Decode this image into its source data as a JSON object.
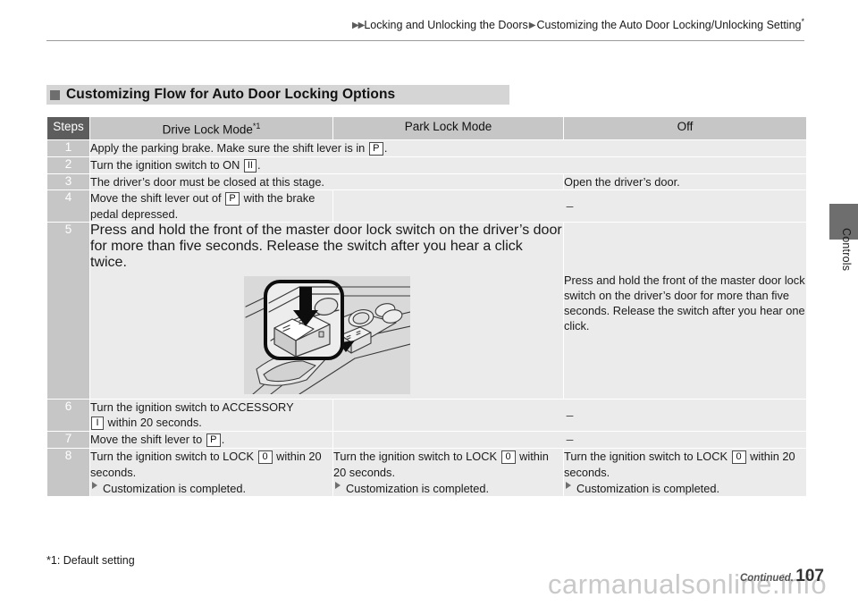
{
  "header": {
    "arrow_double": "▶▶",
    "arrow_single": "▶",
    "breadcrumb_1": "Locking and Unlocking the Doors",
    "breadcrumb_2": "Customizing the Auto Door Locking/Unlocking Setting",
    "breadcrumb_2_sup": "*"
  },
  "thumb_tab": {
    "label": "Controls"
  },
  "section": {
    "title": "Customizing Flow for Auto Door Locking Options"
  },
  "table": {
    "headers": {
      "steps": "Steps",
      "drive_lock_mode": "Drive Lock Mode",
      "drive_lock_mode_sup": "*1",
      "park_lock_mode": "Park Lock Mode",
      "off": "Off"
    },
    "rows": [
      {
        "step": "1",
        "span": "all",
        "drive": {
          "text_a": "Apply the parking brake. Make sure the shift lever is in ",
          "glyph": "P",
          "text_b": "."
        }
      },
      {
        "step": "2",
        "span": "all",
        "drive": {
          "text_a": "Turn the ignition switch to ON ",
          "glyph": "II",
          "text_b": "."
        }
      },
      {
        "step": "3",
        "span": "two-one",
        "drive": {
          "text_a": "The driver’s door must be closed at this stage.",
          "glyph": "",
          "text_b": ""
        },
        "off": {
          "text_a": "Open the driver’s door.",
          "glyph": "",
          "text_b": ""
        }
      },
      {
        "step": "4",
        "span": "one-two",
        "drive": {
          "text_a": "Move the shift lever out of ",
          "glyph": "P",
          "text_b": " with the brake pedal depressed."
        },
        "merged": "–"
      },
      {
        "step": "5",
        "span": "two-one-illus",
        "drive": {
          "text_a": "Press and hold the front of the master door lock switch on the driver’s door for more than five seconds. Release the switch after you hear a click twice."
        },
        "off": {
          "text_a": "Press and hold the front of the master door lock switch on the driver’s door for more than five seconds. Release the switch after you hear one click."
        },
        "illustration_name": "door-panel-master-lock-switch"
      },
      {
        "step": "6",
        "span": "one-two",
        "drive": {
          "text_a": "Turn the ignition switch to ACCESSORY ",
          "glyph": "I",
          "text_b": " within 20 seconds."
        },
        "merged": "–"
      },
      {
        "step": "7",
        "span": "one-two",
        "drive": {
          "text_a": "Move the shift lever to ",
          "glyph": "P",
          "text_b": "."
        },
        "merged": "–"
      },
      {
        "step": "8",
        "span": "three",
        "drive": {
          "text_a": "Turn the ignition switch to LOCK ",
          "glyph": "0",
          "text_b": " within 20 seconds.",
          "sub": "Customization is completed."
        },
        "park": {
          "text_a": "Turn the ignition switch to LOCK ",
          "glyph": "0",
          "text_b": " within 20 seconds.",
          "sub": "Customization is completed."
        },
        "off": {
          "text_a": "Turn the ignition switch to LOCK ",
          "glyph": "0",
          "text_b": " within 20 seconds.",
          "sub": "Customization is completed."
        }
      }
    ]
  },
  "footnote": "*1: Default setting",
  "watermark": "carmanualsonline.info",
  "footer": {
    "continued": "Continued.",
    "page_number": "107"
  },
  "colors": {
    "header_dark": "#5d5d5d",
    "header_light": "#c6c6c6",
    "cell_bg": "#ebebeb",
    "step_bg": "#c6c6c6",
    "title_bar": "#d5d5d5",
    "tab": "#6e6e6e"
  }
}
